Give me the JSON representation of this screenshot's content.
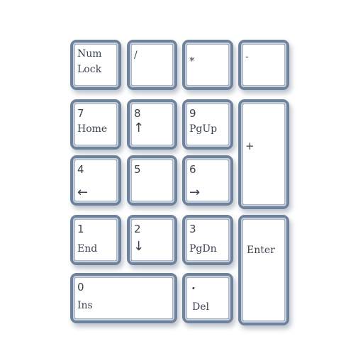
{
  "keypad": {
    "numlock": {
      "line1": "Num",
      "line2": "Lock"
    },
    "divide": {
      "label": "/"
    },
    "multiply": {
      "label": "*"
    },
    "subtract": {
      "label": "-"
    },
    "key7": {
      "digit": "7",
      "alt": "Home"
    },
    "key8": {
      "digit": "8",
      "arrow": "↑"
    },
    "key9": {
      "digit": "9",
      "alt": "PgUp"
    },
    "add": {
      "label": "+"
    },
    "key4": {
      "digit": "4",
      "arrow": "←"
    },
    "key5": {
      "digit": "5"
    },
    "key6": {
      "digit": "6",
      "arrow": "→"
    },
    "key1": {
      "digit": "1",
      "alt": "End"
    },
    "key2": {
      "digit": "2",
      "arrow": "↓"
    },
    "key3": {
      "digit": "3",
      "alt": "PgDn"
    },
    "enter": {
      "label": "Enter"
    },
    "key0": {
      "digit": "0",
      "alt": "Ins"
    },
    "decimal": {
      "digit": ".",
      "alt": "Del"
    }
  },
  "colors": {
    "key_border": "#6f829b",
    "key_face": "#ffffff",
    "text": "#3c4350"
  }
}
